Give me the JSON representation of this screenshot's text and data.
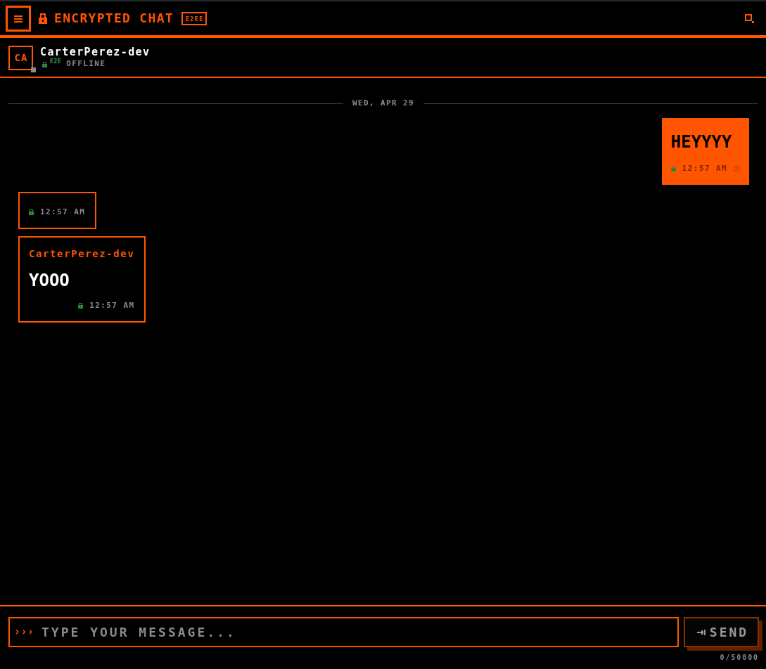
{
  "header": {
    "title": "ENCRYPTED CHAT",
    "badge": "E2EE"
  },
  "contact": {
    "initials": "CA",
    "name": "CarterPerez-dev",
    "encryption_label": "E2E",
    "status": "OFFLINE",
    "online": false
  },
  "date_divider": "WED, APR 29",
  "messages": [
    {
      "kind": "outgoing",
      "text": "HEYYYY",
      "time": "12:57 AM",
      "encrypted": true,
      "pending": true
    },
    {
      "kind": "incoming",
      "time": "12:57 AM",
      "encrypted": true,
      "pending": false
    },
    {
      "kind": "incoming",
      "sender": "CarterPerez-dev",
      "text": "YOOO",
      "time": "12:57 AM",
      "encrypted": true,
      "pending": false
    }
  ],
  "composer": {
    "prompt": "›››",
    "placeholder": "TYPE YOUR MESSAGE...",
    "send_label": "SEND",
    "counter": "0/50000"
  }
}
